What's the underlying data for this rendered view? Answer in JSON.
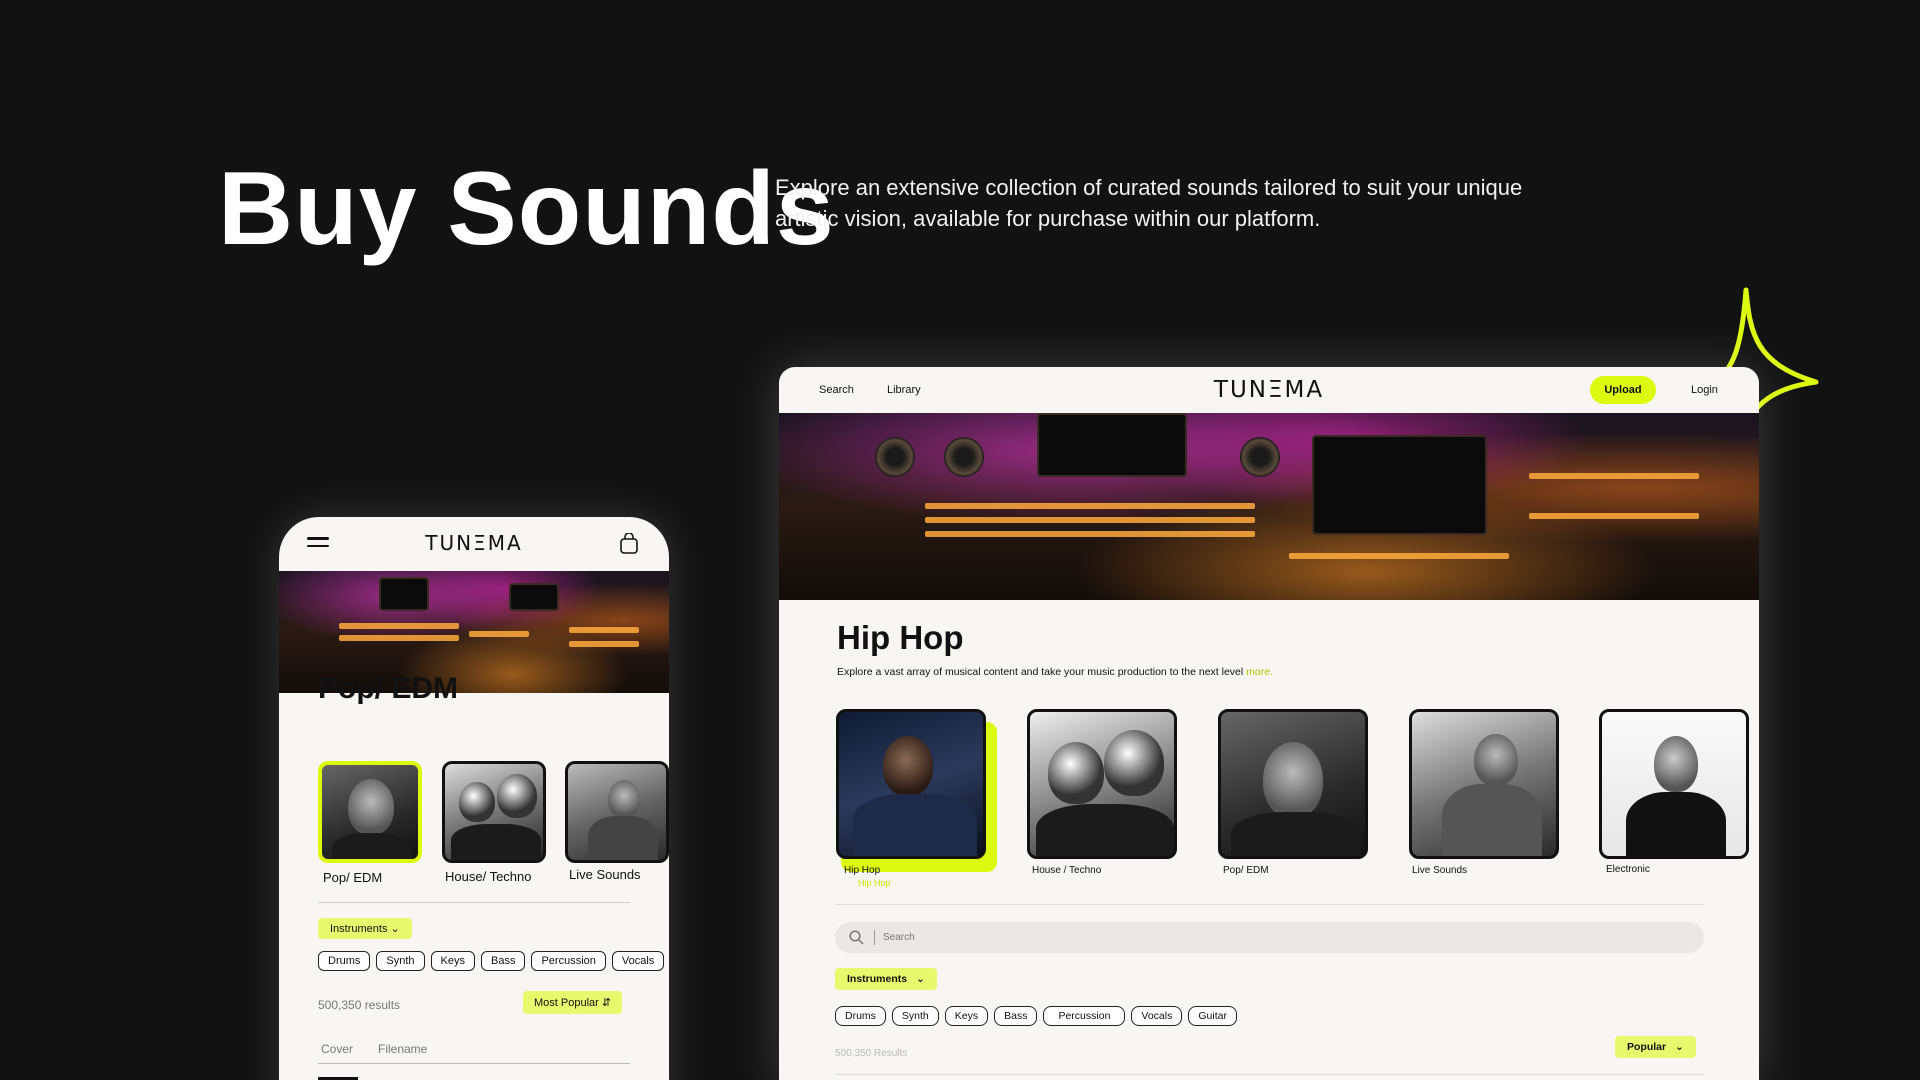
{
  "hero": {
    "title": "Buy Sounds",
    "description": "Explore an extensive collection of  curated sounds tailored to suit your unique artistic vision, available for purchase within our platform."
  },
  "colors": {
    "accent": "#dcfa10",
    "accent_soft": "#e6fa6e",
    "background": "#121212",
    "surface": "#f7f6f2"
  },
  "brand": "TUNΞMA",
  "mobile": {
    "menu_icon": "hamburger-icon",
    "cart_icon": "shopping-bag-icon",
    "genre_title": "Pop/ EDM",
    "artists": [
      {
        "label": "Pop/ EDM"
      },
      {
        "label": "House/ Techno"
      },
      {
        "label": "Live Sounds"
      }
    ],
    "instruments_label": "Instruments",
    "chips": [
      "Drums",
      "Synth",
      "Keys",
      "Bass",
      "Percussion",
      "Vocals"
    ],
    "results": "500,350 results",
    "sort_label": "Most Popular",
    "columns": [
      "Cover",
      "Filename"
    ]
  },
  "desktop": {
    "nav": {
      "search": "Search",
      "library": "Library",
      "upload": "Upload",
      "login": "Login"
    },
    "genre_title": "Hip Hop",
    "genre_desc": "Explore a vast array of musical content and take your music production to the next level",
    "more_link": "more.",
    "artists": [
      {
        "label": "Hip Hop",
        "sub": "Hip Hop"
      },
      {
        "label": "House / Techno"
      },
      {
        "label": "Pop/ EDM"
      },
      {
        "label": "Live Sounds"
      },
      {
        "label": "Electronic"
      }
    ],
    "search_placeholder": "Search",
    "instruments_label": "Instruments",
    "chips": [
      "Drums",
      "Synth",
      "Keys",
      "Bass",
      "Percussion",
      "Vocals",
      "Guitar"
    ],
    "results": "500,350 Results",
    "sort_label": "Popular"
  }
}
